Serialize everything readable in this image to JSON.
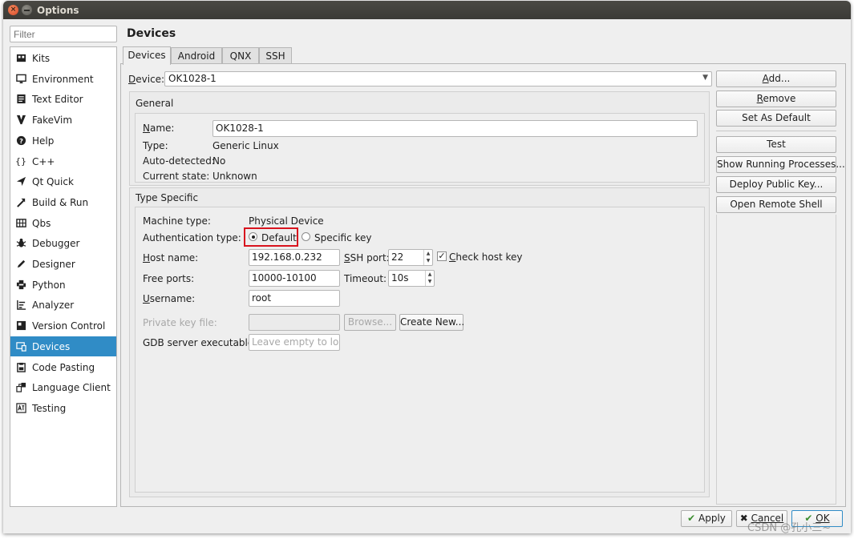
{
  "window": {
    "title": "Options"
  },
  "filter": {
    "placeholder": "Filter"
  },
  "sidebar": {
    "items": [
      {
        "label": "Kits",
        "icon": "kits-icon"
      },
      {
        "label": "Environment",
        "icon": "monitor-icon"
      },
      {
        "label": "Text Editor",
        "icon": "text-editor-icon"
      },
      {
        "label": "FakeVim",
        "icon": "fakevim-icon"
      },
      {
        "label": "Help",
        "icon": "help-icon"
      },
      {
        "label": "C++",
        "icon": "braces-icon"
      },
      {
        "label": "Qt Quick",
        "icon": "qt-quick-icon"
      },
      {
        "label": "Build & Run",
        "icon": "build-run-icon"
      },
      {
        "label": "Qbs",
        "icon": "qbs-icon"
      },
      {
        "label": "Debugger",
        "icon": "bug-icon"
      },
      {
        "label": "Designer",
        "icon": "designer-pen-icon"
      },
      {
        "label": "Python",
        "icon": "python-icon"
      },
      {
        "label": "Analyzer",
        "icon": "analyzer-icon"
      },
      {
        "label": "Version Control",
        "icon": "version-control-icon"
      },
      {
        "label": "Devices",
        "icon": "devices-icon",
        "selected": true
      },
      {
        "label": "Code Pasting",
        "icon": "code-pasting-icon"
      },
      {
        "label": "Language Client",
        "icon": "language-client-icon"
      },
      {
        "label": "Testing",
        "icon": "testing-icon"
      }
    ]
  },
  "page": {
    "title": "Devices"
  },
  "tabs": [
    {
      "label": "Devices",
      "active": true
    },
    {
      "label": "Android"
    },
    {
      "label": "QNX"
    },
    {
      "label": "SSH"
    }
  ],
  "device": {
    "label": "Device:",
    "value": "OK1028-1"
  },
  "general": {
    "title": "General",
    "name_label": "Name:",
    "name_value": "OK1028-1",
    "type_label": "Type:",
    "type_value": "Generic Linux",
    "auto_label": "Auto-detected:",
    "auto_value": "No",
    "state_label": "Current state:",
    "state_value": "Unknown"
  },
  "type_specific": {
    "title": "Type Specific",
    "machine_label": "Machine type:",
    "machine_value": "Physical Device",
    "auth_label": "Authentication type:",
    "auth_default": "Default",
    "auth_specific": "Specific key",
    "auth_selected": "Default",
    "host_label": "Host name:",
    "host_value": "192.168.0.232",
    "ssh_port_label": "SSH port:",
    "ssh_port_value": "22",
    "check_host_key_label": "Check host key",
    "check_host_key_checked": true,
    "free_ports_label": "Free ports:",
    "free_ports_value": "10000-10100",
    "timeout_label": "Timeout:",
    "timeout_value": "10s",
    "username_label": "Username:",
    "username_value": "root",
    "private_key_label": "Private key file:",
    "browse_label": "Browse...",
    "create_new_label": "Create New...",
    "gdb_label": "GDB server executable:",
    "gdb_placeholder": "Leave empty to lo..."
  },
  "actions": {
    "add": "Add...",
    "remove": "Remove",
    "set_default": "Set As Default",
    "test": "Test",
    "show_processes": "Show Running Processes...",
    "deploy_key": "Deploy Public Key...",
    "remote_shell": "Open Remote Shell"
  },
  "footer": {
    "apply": "Apply",
    "cancel": "Cancel",
    "ok": "OK"
  },
  "watermark": "CSDN @孔小三~",
  "colors": {
    "selection": "#308cc6",
    "highlight_box": "#d8131e",
    "titlebar": "#3b3a36"
  }
}
